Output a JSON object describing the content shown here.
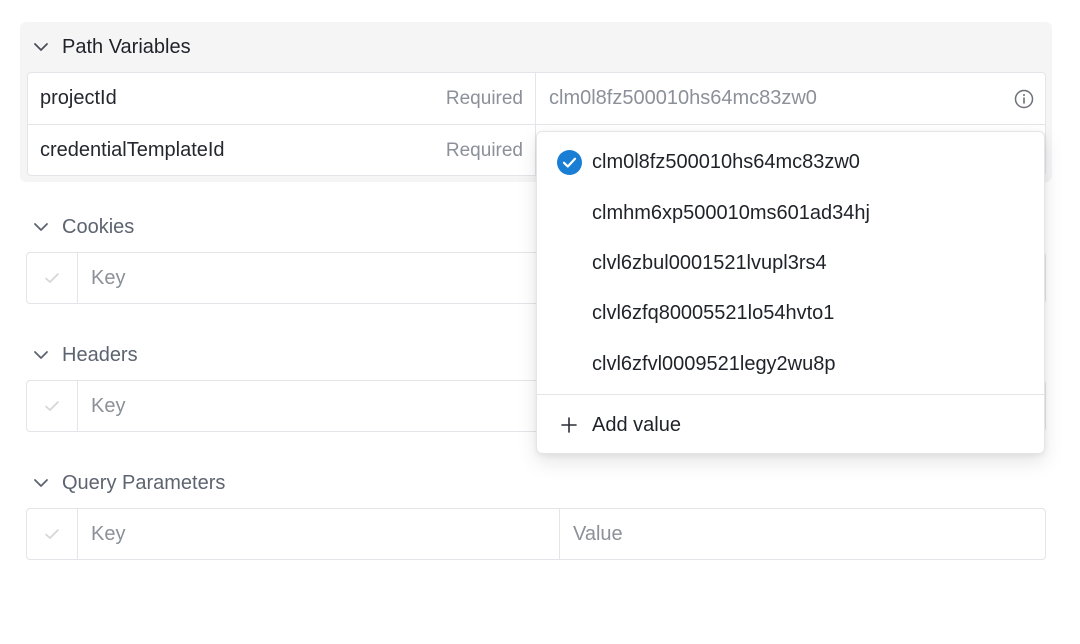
{
  "path_variables": {
    "title": "Path Variables",
    "rows": [
      {
        "name": "projectId",
        "required": "Required",
        "value": "clm0l8fz500010hs64mc83zw0"
      },
      {
        "name": "credentialTemplateId",
        "required": "Required",
        "value": ""
      }
    ]
  },
  "cookies": {
    "title": "Cookies",
    "key_placeholder": "Key"
  },
  "headers": {
    "title": "Headers",
    "key_placeholder": "Key"
  },
  "query_parameters": {
    "title": "Query Parameters",
    "key_placeholder": "Key",
    "value_placeholder": "Value"
  },
  "dropdown": {
    "selected": "clm0l8fz500010hs64mc83zw0",
    "options": [
      "clm0l8fz500010hs64mc83zw0",
      "clmhm6xp500010ms601ad34hj",
      "clvl6zbul0001521lvupl3rs4",
      "clvl6zfq80005521lo54hvto1",
      "clvl6zfvl0009521legy2wu8p"
    ],
    "add_label": "Add value"
  },
  "colors": {
    "accent": "#1a7fd4",
    "border": "#e4e5e8",
    "muted_text": "#8b9099"
  }
}
